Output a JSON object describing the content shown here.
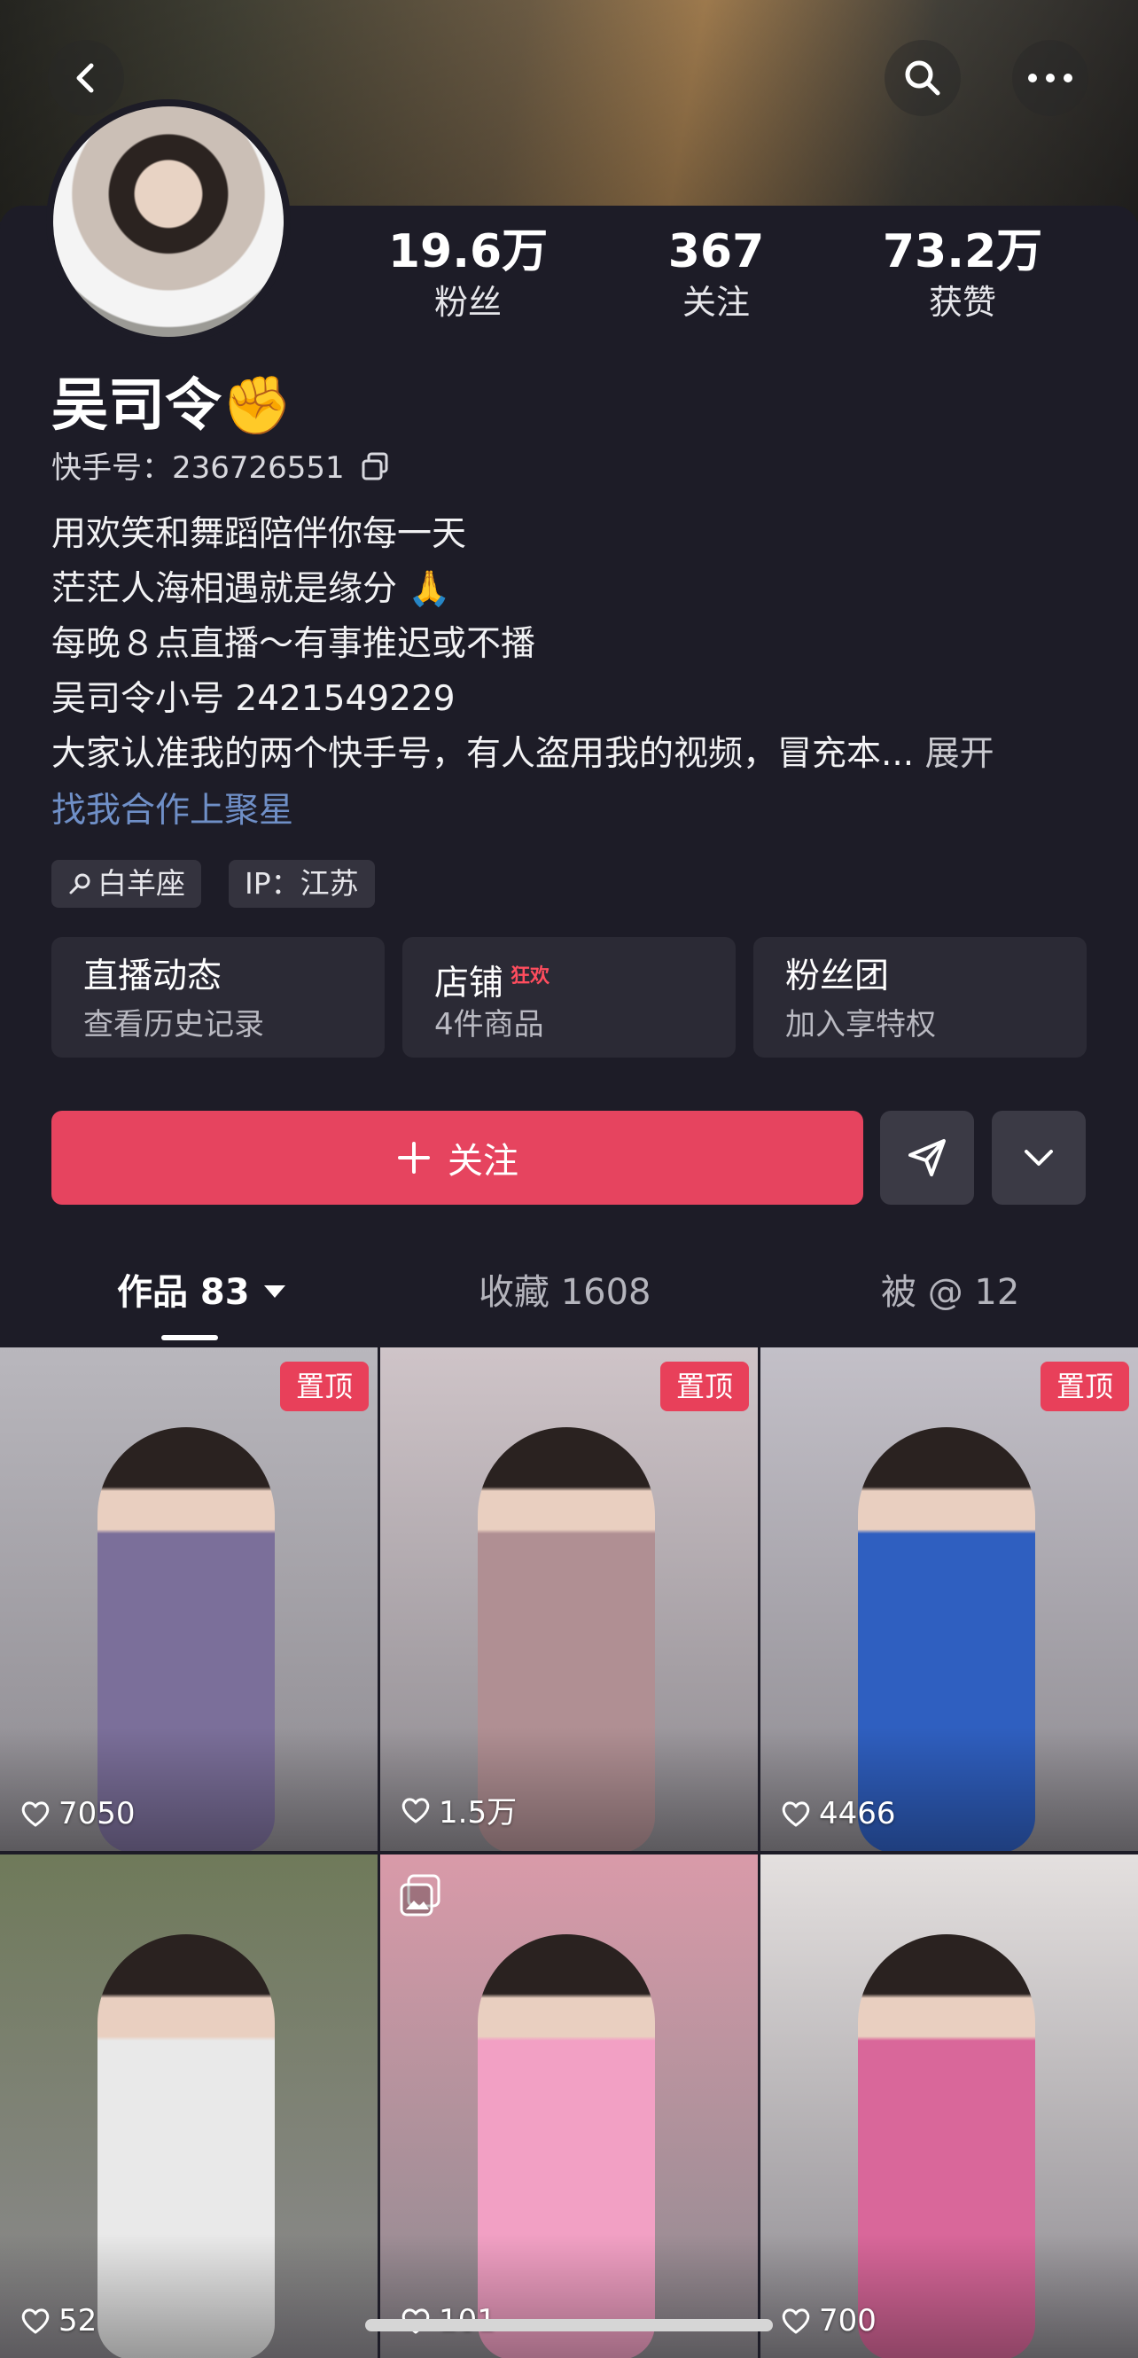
{
  "stats": {
    "fans": {
      "value": "19.6万",
      "label": "粉丝"
    },
    "following": {
      "value": "367",
      "label": "关注"
    },
    "likes": {
      "value": "73.2万",
      "label": "获赞"
    }
  },
  "profile": {
    "name": "吴司令",
    "name_emoji": "✊",
    "uid": "快手号：236726551",
    "bio": [
      "用欢笑和舞蹈陪伴你每一天",
      "茫茫人海相遇就是缘分 🙏",
      "每晚８点直播～有事推迟或不播",
      "吴司令小号 2421549229",
      "大家认准我的两个快手号，有人盗用我的视频，冒充本..."
    ],
    "expand_label": "展开",
    "link_text": "找我合作上聚星",
    "tags": [
      "白羊座",
      "IP：江苏"
    ]
  },
  "cards": [
    {
      "title": "直播动态",
      "subtitle": "查看历史记录",
      "badge": ""
    },
    {
      "title": "店铺",
      "subtitle": "4件商品",
      "badge": "狂欢"
    },
    {
      "title": "粉丝团",
      "subtitle": "加入享特权",
      "badge": ""
    }
  ],
  "actions": {
    "follow_label": "关注"
  },
  "tabs": [
    {
      "label": "作品 83"
    },
    {
      "label": "收藏 1608"
    },
    {
      "label": "被 @ 12"
    }
  ],
  "posts": [
    {
      "likes": "7050",
      "pinned": "置顶",
      "bg": "#b9b7bd",
      "accent": "#7b6f9a"
    },
    {
      "likes": "1.5万",
      "pinned": "置顶",
      "bg": "#cfc4c8",
      "accent": "#b08f93"
    },
    {
      "likes": "4466",
      "pinned": "置顶",
      "bg": "#c3c0c8",
      "accent": "#2f5fc0"
    },
    {
      "likes": "52",
      "pinned": "",
      "bg": "#6f7a5a",
      "accent": "#e9e9e9"
    },
    {
      "likes": "101",
      "pinned": "",
      "bg": "#d99aa9",
      "accent": "#f2a0c4"
    },
    {
      "likes": "700",
      "pinned": "",
      "bg": "#e4e0df",
      "accent": "#d9679a"
    }
  ],
  "colors": {
    "accent": "#e6445f",
    "background": "#1d1c27",
    "link": "#6f8fc7"
  }
}
